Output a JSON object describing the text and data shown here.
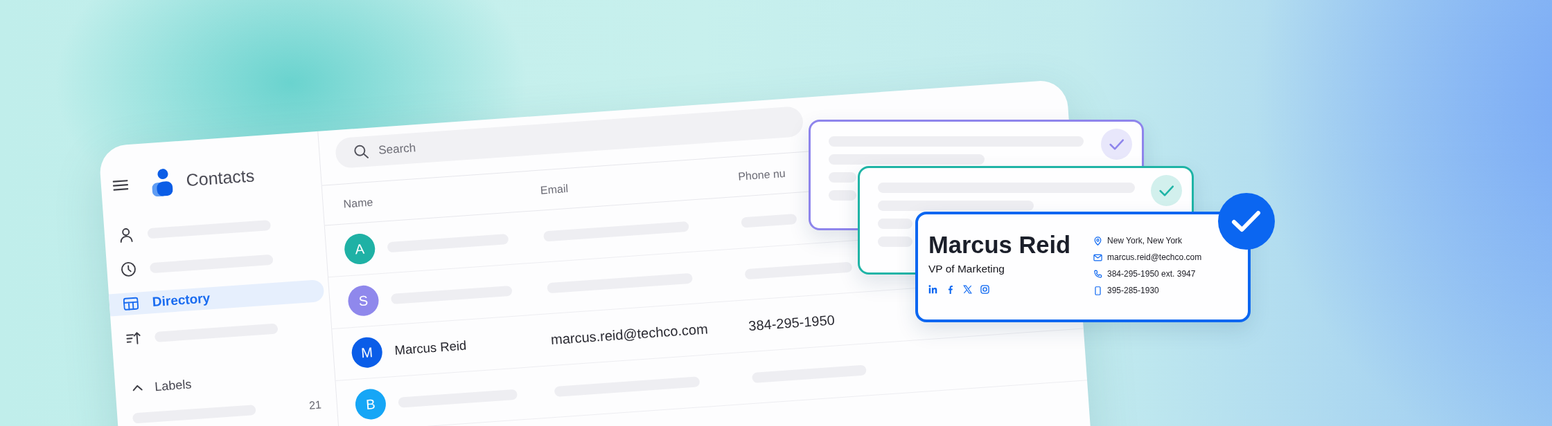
{
  "window": {
    "app_title": "Contacts"
  },
  "sidebar": {
    "nav": [
      {
        "selected": false
      },
      {
        "selected": false
      },
      {
        "label": "Directory",
        "selected": true
      },
      {
        "selected": false
      }
    ],
    "labels": {
      "title": "Labels",
      "expanded": true,
      "items": [
        {
          "count": "21"
        }
      ]
    }
  },
  "search": {
    "placeholder": "Search"
  },
  "table": {
    "columns": [
      "Name",
      "Email",
      "Phone nu"
    ],
    "rows": [
      {
        "kind": "placeholder",
        "avatar": "A",
        "color": "#1fb1a5"
      },
      {
        "kind": "placeholder",
        "avatar": "S",
        "color": "#8f88ec"
      },
      {
        "kind": "contact",
        "avatar": "M",
        "color": "#0a5de8",
        "name": "Marcus Reid",
        "email": "marcus.reid@techco.com",
        "phone": "384-295-1950"
      },
      {
        "kind": "placeholder",
        "avatar": "B",
        "color": "#16a6f6"
      }
    ]
  },
  "cards": [
    {
      "kind": "placeholder",
      "color": "#8e85ec",
      "checked": true
    },
    {
      "kind": "placeholder",
      "color": "#1fb4a6",
      "checked": true
    },
    {
      "kind": "profile",
      "color": "#0b66f1",
      "checked": true,
      "name": "Marcus Reid",
      "title": "VP of Marketing",
      "details": [
        {
          "kind": "location",
          "text": "New York, New York"
        },
        {
          "kind": "email",
          "text": "marcus.reid@techco.com"
        },
        {
          "kind": "phone",
          "text": "384-295-1950 ext. 3947"
        },
        {
          "kind": "mobile",
          "text": "395-285-1930"
        }
      ]
    }
  ]
}
